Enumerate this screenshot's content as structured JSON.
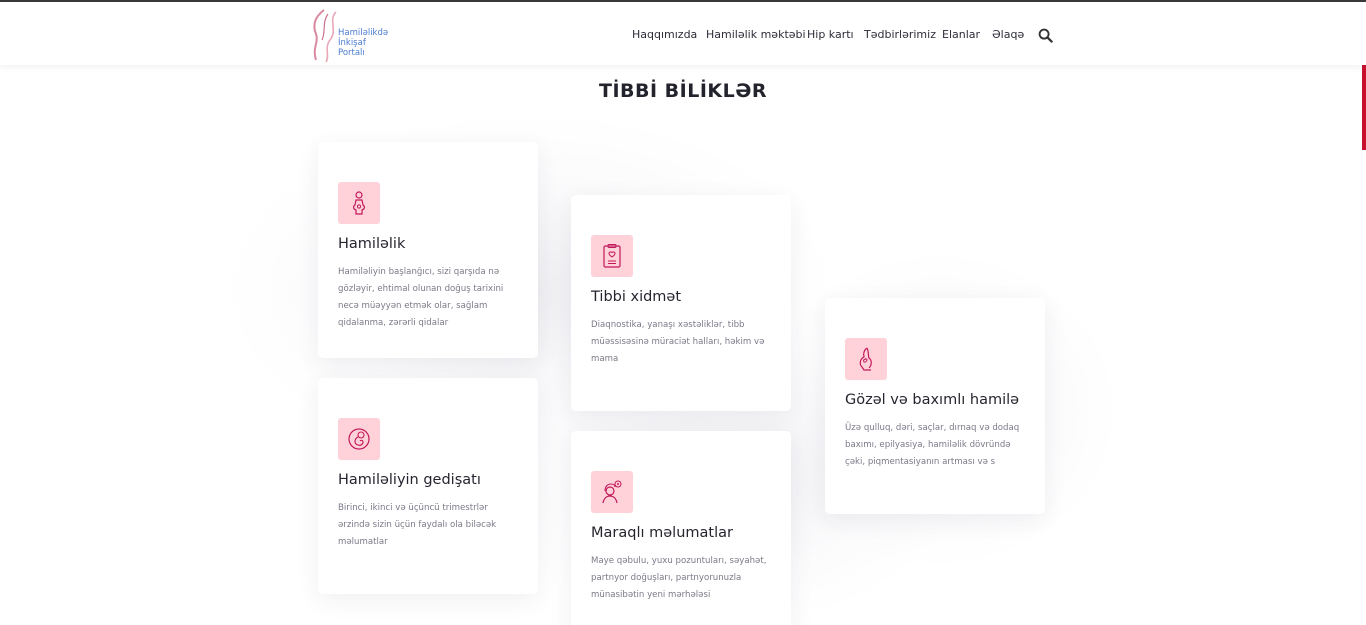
{
  "header": {
    "logo_lines": [
      "Hamiləlikdə",
      "İnkişaf",
      "Portalı"
    ],
    "nav": [
      {
        "label": "Haqqımızda",
        "name": "nav-about"
      },
      {
        "label": "Hamiləlik məktəbi",
        "name": "nav-pregnancy-school"
      },
      {
        "label": "Hip kartı",
        "name": "nav-hip-card"
      },
      {
        "label": "Tədbirlərimiz",
        "name": "nav-events"
      },
      {
        "label": "Elanlar",
        "name": "nav-announcements"
      },
      {
        "label": "Əlaqə",
        "name": "nav-contact"
      }
    ],
    "search_icon": "search-icon"
  },
  "section_title": "TİBBİ BİLİKLƏR",
  "colors": {
    "accent": "#c8102e",
    "icon_bg": "#ffd2da",
    "icon_stroke": "#c2185b",
    "logo_text": "#4a7bd0"
  },
  "cards": [
    {
      "icon": "pregnant-woman-icon",
      "title": "Hamiləlik",
      "text": "Hamiləliyin başlanğıcı, sizi qarşıda nə gözləyir, ehtimal olunan doğuş tarixini necə müəyyən etmək olar, sağlam qidalanma, zərərli qidalar"
    },
    {
      "icon": "medical-clipboard-icon",
      "title": "Tibbi xidmət",
      "text": "Diaqnostika, yanaşı xəstəliklər, tibb müəssisəsinə müraciət halları, həkim və mama"
    },
    {
      "icon": "pregnant-belly-icon",
      "title": "Gözəl və baxımlı hamilə",
      "text": "Üzə qulluq, dəri, saçlar, dırnaq və dodaq baxımı, epilyasiya, hamiləlik dövründə çəki, piqmentasiyanın artması və s"
    },
    {
      "icon": "fetus-icon",
      "title": "Hamiləliyin gedişatı",
      "text": "Birinci, ikinci və üçüncü trimestrlər ərzində sizin üçün faydalı ola biləcək məlumatlar"
    },
    {
      "icon": "woman-thinking-icon",
      "title": "Maraqlı məlumatlar",
      "text": "Maye qəbulu, yuxu pozuntuları, səyahət, partnyor doğuşları, partnyorunuzla münasibətin yeni mərhələsi"
    }
  ]
}
